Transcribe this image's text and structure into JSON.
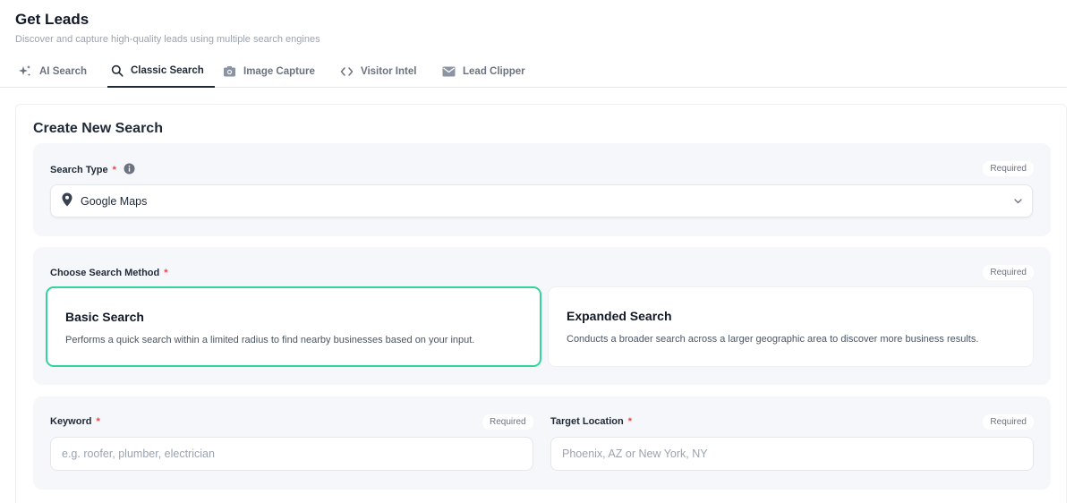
{
  "header": {
    "title": "Get Leads",
    "subtitle": "Discover and capture high-quality leads using multiple search engines"
  },
  "tabs": [
    {
      "label": "AI Search",
      "icon": "sparkles-icon",
      "active": false
    },
    {
      "label": "Classic Search",
      "icon": "search-icon",
      "active": true
    },
    {
      "label": "Image Capture",
      "icon": "camera-icon",
      "active": false
    },
    {
      "label": "Visitor Intel",
      "icon": "code-icon",
      "active": false
    },
    {
      "label": "Lead Clipper",
      "icon": "mail-icon",
      "active": false
    }
  ],
  "form": {
    "title": "Create New Search",
    "search_type": {
      "label": "Search Type",
      "required_star": "*",
      "required_badge": "Required",
      "value": "Google Maps"
    },
    "search_method": {
      "label": "Choose Search Method",
      "required_star": "*",
      "required_badge": "Required",
      "options": [
        {
          "title": "Basic Search",
          "description": "Performs a quick search within a limited radius to find nearby businesses based on your input.",
          "selected": true
        },
        {
          "title": "Expanded Search",
          "description": "Conducts a broader search across a larger geographic area to discover more business results.",
          "selected": false
        }
      ]
    },
    "keyword": {
      "label": "Keyword",
      "required_star": "*",
      "required_badge": "Required",
      "value": "",
      "placeholder": "e.g. roofer, plumber, electrician"
    },
    "target_location": {
      "label": "Target Location",
      "required_star": "*",
      "required_badge": "Required",
      "value": "",
      "placeholder": "Phoenix, AZ or New York, NY"
    }
  },
  "colors": {
    "accent_selected": "#34d399",
    "required_star": "#ef4444",
    "section_bg": "#f5f7fa"
  }
}
